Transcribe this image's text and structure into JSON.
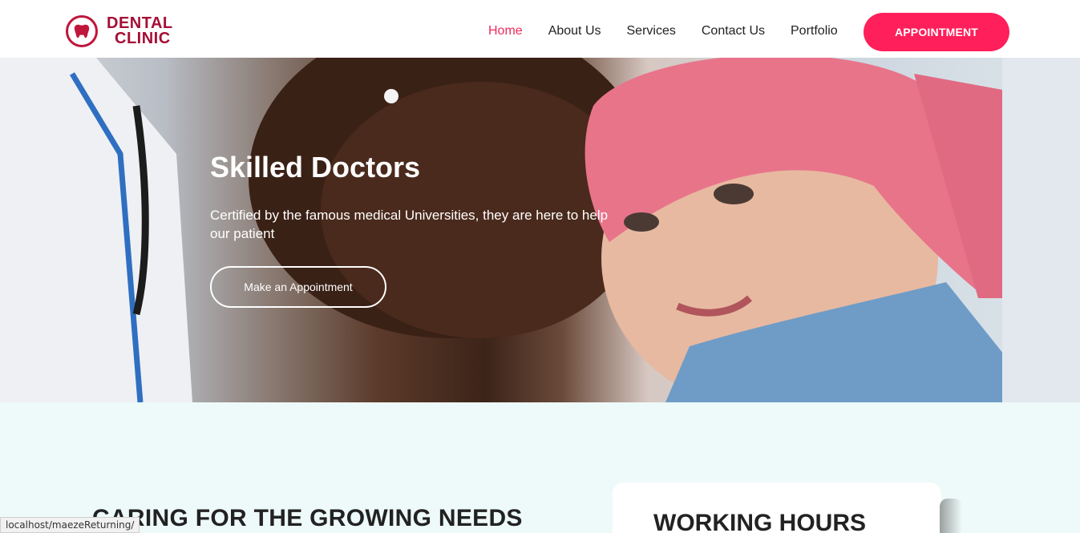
{
  "brand": {
    "line1": "DENTAL",
    "line2": "CLINIC",
    "color": "#a50f35"
  },
  "nav": {
    "items": [
      {
        "label": "Home",
        "active": true
      },
      {
        "label": "About Us",
        "active": false
      },
      {
        "label": "Services",
        "active": false
      },
      {
        "label": "Contact Us",
        "active": false
      },
      {
        "label": "Portfolio",
        "active": false
      }
    ],
    "cta": "APPOINTMENT",
    "accent": "#ff1f5a"
  },
  "hero": {
    "title": "Skilled Doctors",
    "subtitle": "Certified by the famous medical Universities, they are here to help our patient",
    "button": "Make an Appointment"
  },
  "section": {
    "heading": "CARING FOR THE GROWING NEEDS",
    "card_title": "WORKING HOURS",
    "background": "#eefaf9"
  },
  "status_bar": {
    "url": "localhost/maezeReturning/"
  }
}
